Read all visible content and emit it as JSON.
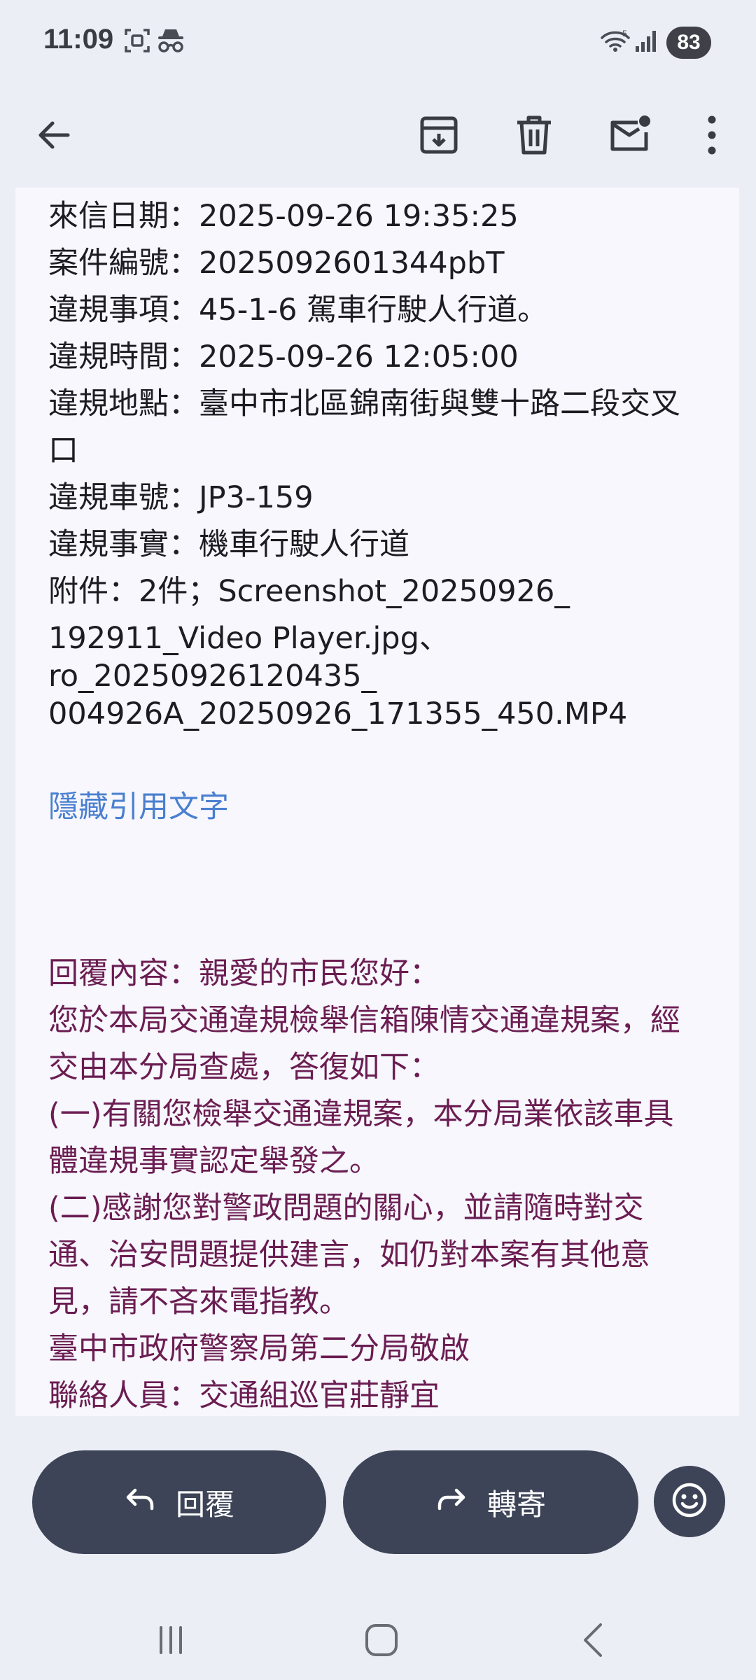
{
  "status_bar": {
    "time": "11:09",
    "battery": "83",
    "icons": [
      "screenshot-icon",
      "incognito-icon",
      "wifi-icon",
      "signal-icon"
    ]
  },
  "app_bar": {
    "icons": [
      "back-arrow-icon",
      "archive-icon",
      "delete-icon",
      "mark-unread-icon",
      "more-vert-icon"
    ]
  },
  "email": {
    "lines": [
      "來信日期：2025-09-26 19:35:25",
      "案件編號：2025092601344pbT",
      "違規事項：45-1-6 駕車行駛人行道。",
      "違規時間：2025-09-26 12:05:00",
      "違規地點：臺中市北區錦南街與雙十路二段交叉",
      "口",
      "違規車號：JP3-159",
      "違規事實：機車行駛人行道",
      "附件：2件；Screenshot_20250926_",
      "192911_Video Player.jpg、",
      "ro_20250926120435_",
      "004926A_20250926_171355_450.MP4"
    ],
    "hide_quoted_label": "隱藏引用文字",
    "reply_lines": [
      "回覆內容：親愛的市民您好：",
      "您於本局交通違規檢舉信箱陳情交通違規案，經",
      "交由本分局查處，答復如下：",
      "(一)有關您檢舉交通違規案，本分局業依該車具",
      "體違規事實認定舉發之。",
      "(二)感謝您對警政問題的關心，並請隨時對交",
      "通、治安問題提供建言，如仍對本案有其他意",
      "見，請不吝來電指教。",
      "臺中市政府警察局第二分局敬啟",
      "聯絡人員：交通組巡官莊靜宜"
    ]
  },
  "actions": {
    "reply_label": "回覆",
    "forward_label": "轉寄"
  },
  "colors": {
    "background": "#eceef6",
    "content_bg": "#f7f7fd",
    "reply_text": "#6b1d52",
    "link": "#4a7fd0",
    "pill": "#3d4457"
  }
}
